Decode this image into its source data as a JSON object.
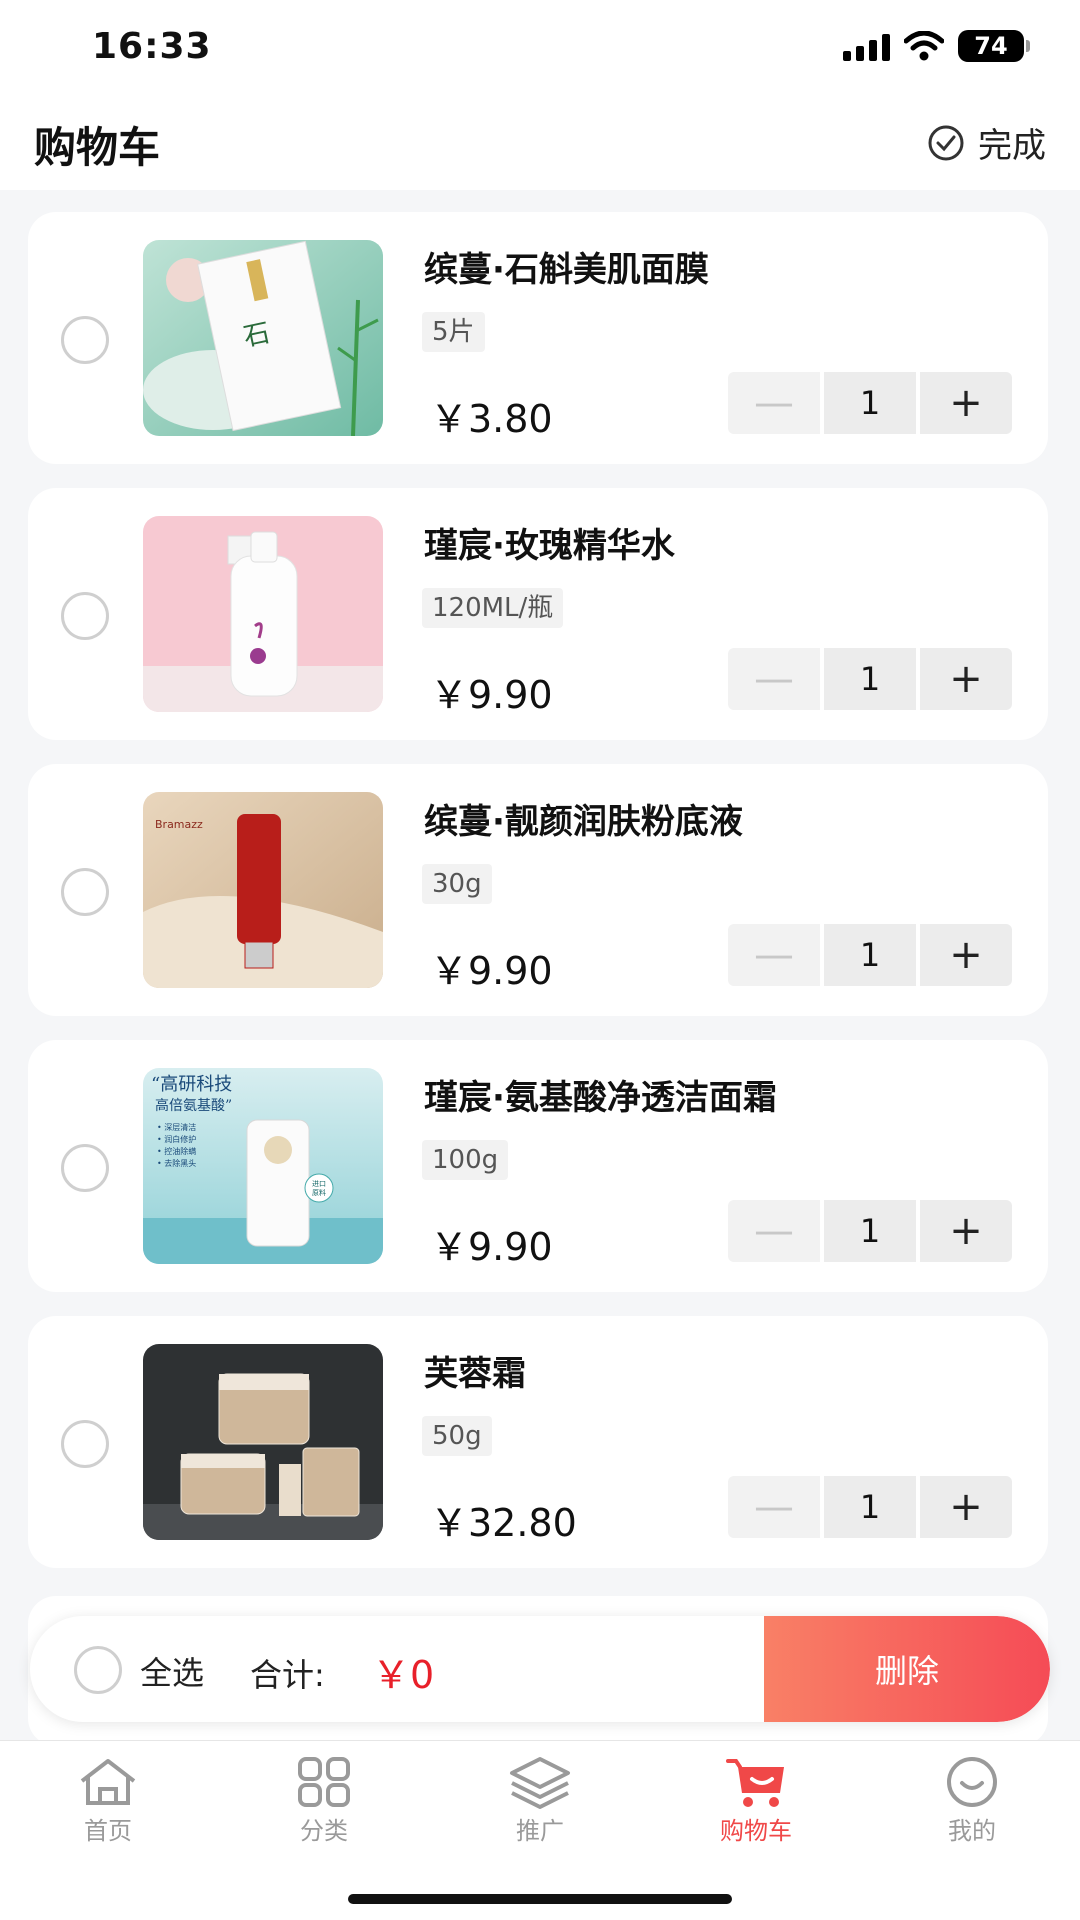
{
  "status_bar": {
    "time": "16:33",
    "battery": "74"
  },
  "header": {
    "title": "购物车",
    "done_label": "完成"
  },
  "cart_items": [
    {
      "name": "缤蔓·石斛美肌面膜",
      "spec": "5片",
      "price": "￥3.80",
      "qty": "1",
      "minus": "—",
      "plus": "+"
    },
    {
      "name": "瑾宸·玫瑰精华水",
      "spec": "120ML/瓶",
      "price": "￥9.90",
      "qty": "1",
      "minus": "—",
      "plus": "+"
    },
    {
      "name": "缤蔓·靓颜润肤粉底液",
      "spec": "30g",
      "price": "￥9.90",
      "qty": "1",
      "minus": "—",
      "plus": "+"
    },
    {
      "name": "瑾宸·氨基酸净透洁面霜",
      "spec": "100g",
      "price": "￥9.90",
      "qty": "1",
      "minus": "—",
      "plus": "+"
    },
    {
      "name": "芙蓉霜",
      "spec": "50g",
      "price": "￥32.80",
      "qty": "1",
      "minus": "—",
      "plus": "+"
    }
  ],
  "product_images": {
    "item3": {
      "lines": [
        "“高研科技",
        "高倍氨基酸”",
        "• 深层清洁",
        "• 润白修护",
        "• 控油除螨",
        "• 去除黑头"
      ],
      "badge": [
        "进口",
        "原料"
      ]
    },
    "item2": {
      "brand": "Bramazz"
    }
  },
  "checkout": {
    "select_all": "全选",
    "total_label": "合计:",
    "total_value": "￥0",
    "delete_label": "删除"
  },
  "tabs": [
    {
      "label": "首页",
      "icon": "home-icon"
    },
    {
      "label": "分类",
      "icon": "grid-icon"
    },
    {
      "label": "推广",
      "icon": "layers-icon"
    },
    {
      "label": "购物车",
      "icon": "cart-icon",
      "active": true
    },
    {
      "label": "我的",
      "icon": "smile-icon"
    }
  ],
  "colors": {
    "accent": "#f04848",
    "price_red": "#e8202a",
    "delete_gradient_start": "#f98066",
    "delete_gradient_end": "#f54b56"
  }
}
